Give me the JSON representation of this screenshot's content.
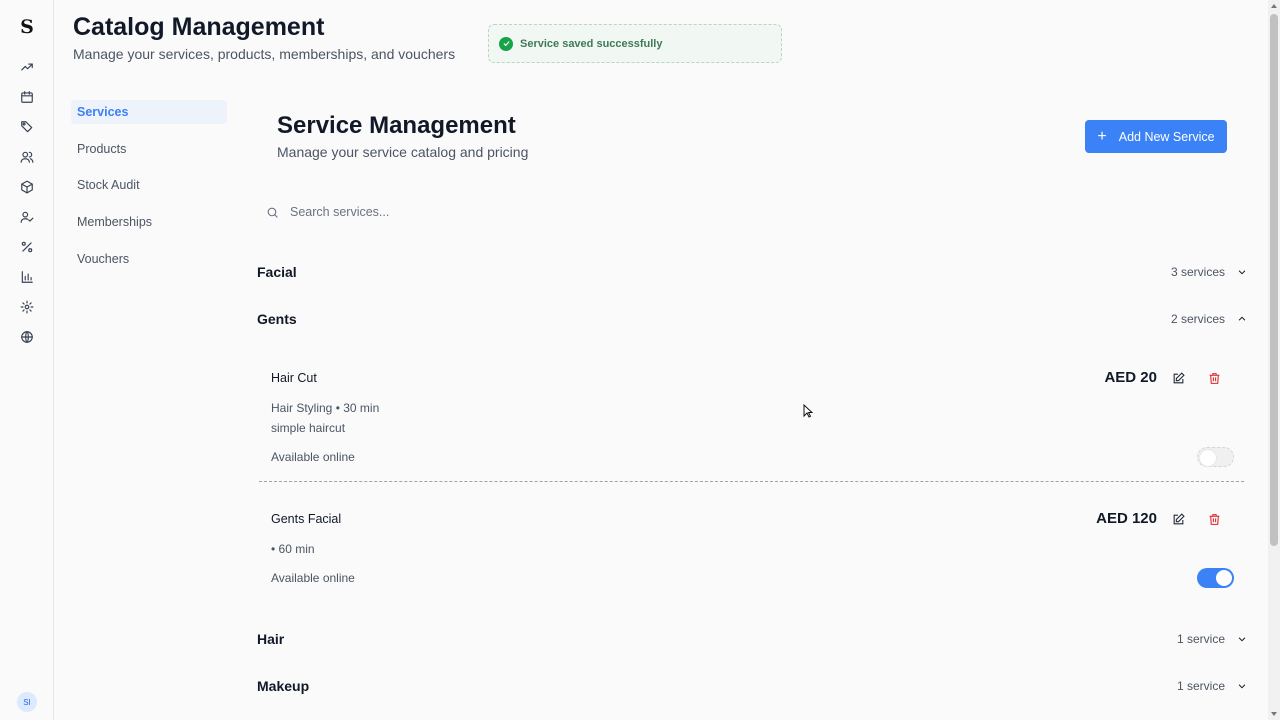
{
  "app": {
    "logo": "S",
    "avatar_initials": "SI"
  },
  "rail_icons": [
    "trending-up-icon",
    "calendar-icon",
    "tag-icon",
    "users-icon",
    "box-icon",
    "user-check-icon",
    "percent-icon",
    "bar-chart-icon",
    "settings-icon",
    "globe-icon"
  ],
  "header": {
    "title": "Catalog Management",
    "subtitle": "Manage your services, products, memberships, and vouchers"
  },
  "toast": {
    "message": "Service saved successfully",
    "icon": "check-circle-icon"
  },
  "subnav": {
    "items": [
      {
        "label": "Services",
        "active": true
      },
      {
        "label": "Products",
        "active": false
      },
      {
        "label": "Stock Audit",
        "active": false
      },
      {
        "label": "Memberships",
        "active": false
      },
      {
        "label": "Vouchers",
        "active": false
      }
    ]
  },
  "main": {
    "title": "Service Management",
    "subtitle": "Manage your service catalog and pricing",
    "add_button_label": "Add New Service",
    "search_placeholder": "Search services...",
    "categories": [
      {
        "name": "Facial",
        "count": "3 services",
        "expanded": false
      },
      {
        "name": "Gents",
        "count": "2 services",
        "expanded": true
      },
      {
        "name": "Hair",
        "count": "1 service",
        "expanded": false
      },
      {
        "name": "Makeup",
        "count": "1 service",
        "expanded": false
      }
    ],
    "services": [
      {
        "name": "Hair Cut",
        "meta": "Hair Styling • 30 min",
        "description": "simple haircut",
        "online_label": "Available online",
        "price": "AED 20",
        "online": false
      },
      {
        "name": "Gents Facial",
        "meta": "• 60 min",
        "description": "",
        "online_label": "Available online",
        "price": "AED 120",
        "online": true
      }
    ]
  },
  "colors": {
    "accent": "#3b82f6",
    "danger": "#dc2626",
    "success": "#16a34a"
  }
}
